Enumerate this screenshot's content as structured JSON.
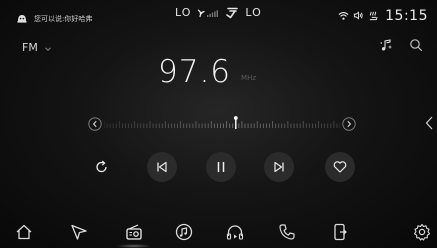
{
  "status": {
    "assistant_text": "您可以说:你好哈弗",
    "left_temp": "LO",
    "right_temp": "LO",
    "time": "15:15"
  },
  "header": {
    "band": "FM",
    "icons": [
      "music-note-icon",
      "search-icon"
    ]
  },
  "tuner": {
    "frequency": "97.6",
    "unit": "MHz"
  },
  "controls": [
    "refresh-icon",
    "previous-icon",
    "pause-icon",
    "next-icon",
    "favorite-icon"
  ],
  "dock": [
    "home",
    "navigation",
    "radio",
    "music",
    "audiobook",
    "phone",
    "apps",
    "settings"
  ],
  "colors": {
    "background": "#141414",
    "text": "#e8e8e8",
    "control_disc": "#2b2b2b",
    "muted": "#5a5a5a"
  }
}
